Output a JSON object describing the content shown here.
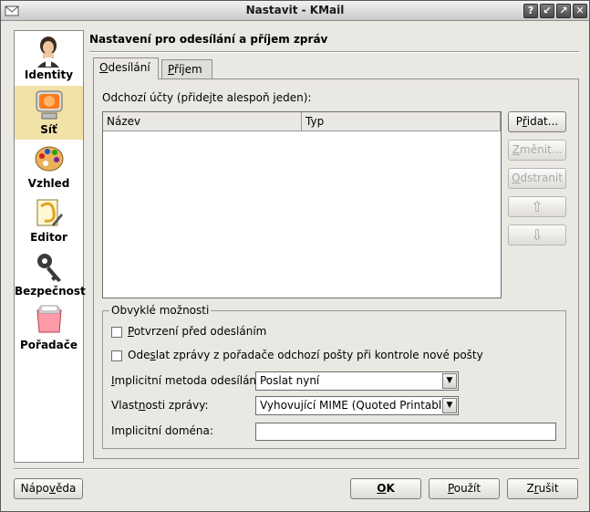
{
  "window": {
    "title": "Nastavit - KMail"
  },
  "titlebar_buttons": [
    {
      "name": "help-icon",
      "glyph": "?"
    },
    {
      "name": "minimize-icon",
      "glyph": "↙"
    },
    {
      "name": "maximize-icon",
      "glyph": "↗"
    },
    {
      "name": "close-icon",
      "glyph": "✕"
    }
  ],
  "sidebar": {
    "items": [
      {
        "label": "Identity",
        "icon": "identity-person-icon"
      },
      {
        "label": "Síť",
        "icon": "network-icon",
        "selected": true
      },
      {
        "label": "Vzhled",
        "icon": "palette-icon"
      },
      {
        "label": "Editor",
        "icon": "editor-icon"
      },
      {
        "label": "Bezpečnost",
        "icon": "key-icon"
      },
      {
        "label": "Pořadače",
        "icon": "folders-icon"
      }
    ]
  },
  "page": {
    "title": "Nastavení pro odesílání a příjem zpráv"
  },
  "tabs": [
    {
      "label_u": "O",
      "label_rest": "desílání",
      "active": true
    },
    {
      "label_u": "P",
      "label_rest": "říjem",
      "active": false
    }
  ],
  "accounts": {
    "label": "Odchozí účty (přidejte alespoň jeden):",
    "columns": [
      "Název",
      "Typ"
    ],
    "rows": []
  },
  "buttons": {
    "add": {
      "pre": "P",
      "u": "ř",
      "post": "idat..."
    },
    "change": {
      "pre": "",
      "u": "Z",
      "post": "měnit..."
    },
    "remove": {
      "pre": "",
      "u": "O",
      "post": "dstranit"
    },
    "up_glyph": "⇧",
    "down_glyph": "⇩"
  },
  "common": {
    "title": "Obvyklé možnosti",
    "confirm": {
      "pre": "",
      "u": "P",
      "post": "otvrzení před odesláním"
    },
    "send_on_check": {
      "pre": "Ode",
      "u": "s",
      "post": "lat zprávy z pořadače odchozí pošty při kontrole nové pošty"
    },
    "method_label": {
      "pre": "",
      "u": "I",
      "post": "mplicitní metoda odesílání:"
    },
    "method_value": "Poslat nyní",
    "props_label": {
      "pre": "Vlast",
      "u": "n",
      "post": "osti zprávy:"
    },
    "props_value": "Vyhovující MIME (Quoted Printable)",
    "domain_label": "Implicitní doména:",
    "domain_value": ""
  },
  "footer": {
    "help": {
      "pre": "Nápo",
      "u": "v",
      "post": "ěda"
    },
    "ok": {
      "pre": "",
      "u": "O",
      "post": "K"
    },
    "apply": {
      "pre": "",
      "u": "P",
      "post": "oužít"
    },
    "cancel": {
      "pre": "Z",
      "u": "r",
      "post": "ušit"
    }
  }
}
